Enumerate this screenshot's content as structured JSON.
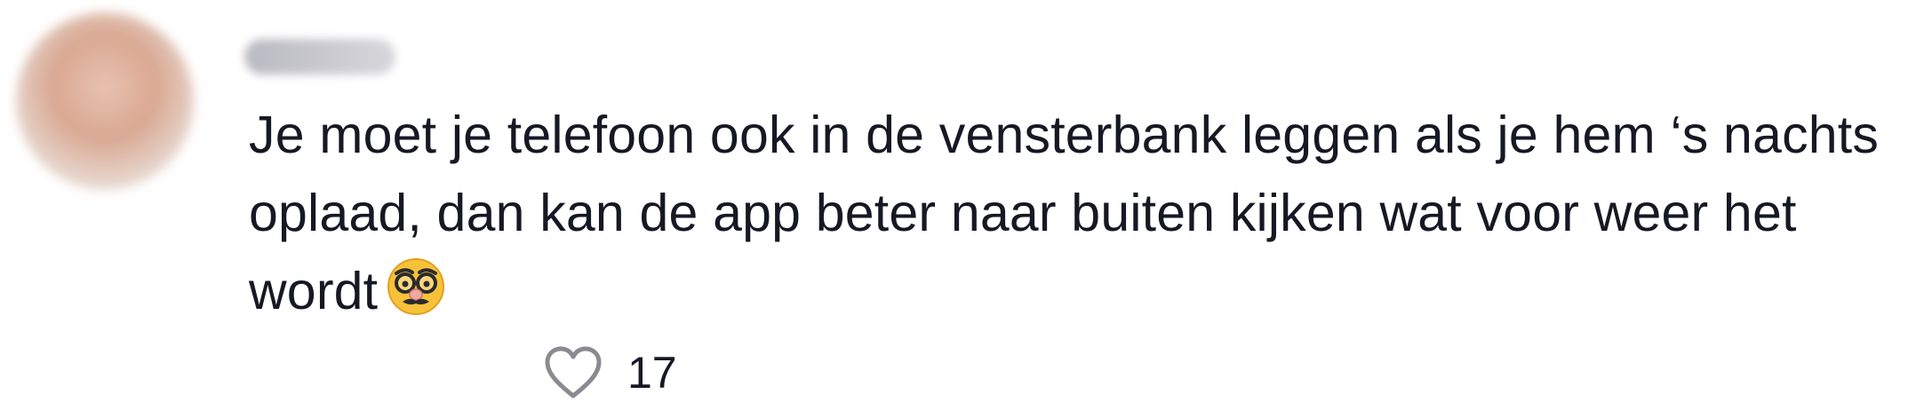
{
  "comment": {
    "username": "",
    "text": "Je moet je telefoon ook in de vensterbank leggen als je hem ‘s nachts oplaad, dan kan de app beter naar buiten kijken wat voor weer het wordt",
    "emoji": "disguised-face-emoji",
    "like_count": "17"
  },
  "icons": {
    "like": "heart-outline-icon"
  },
  "colors": {
    "text": "#161823",
    "heart_stroke": "#8a8b91",
    "background": "#ffffff"
  }
}
